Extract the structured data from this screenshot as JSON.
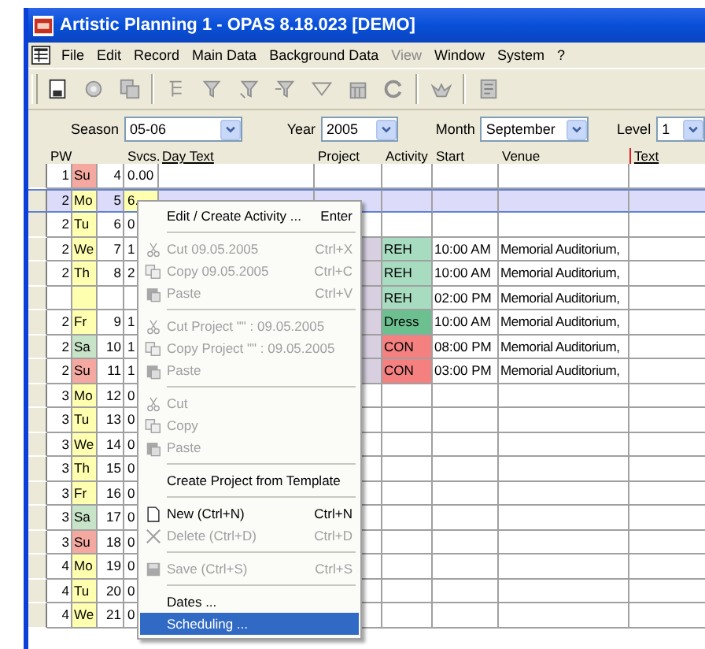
{
  "window": {
    "title": "Artistic Planning  1 - OPAS 8.18.023  [DEMO]"
  },
  "menu_bar": [
    {
      "label": "File",
      "disabled": false
    },
    {
      "label": "Edit",
      "disabled": false
    },
    {
      "label": "Record",
      "disabled": false
    },
    {
      "label": "Main Data",
      "disabled": false
    },
    {
      "label": "Background Data",
      "disabled": false
    },
    {
      "label": "View",
      "disabled": true
    },
    {
      "label": "Window",
      "disabled": false
    },
    {
      "label": "System",
      "disabled": false
    },
    {
      "label": "?",
      "disabled": false
    }
  ],
  "filters": [
    {
      "label": "Season",
      "value": "05-06"
    },
    {
      "label": "Year",
      "value": "2005"
    },
    {
      "label": "Month",
      "value": "September"
    },
    {
      "label": "Level",
      "value": "1"
    }
  ],
  "table": {
    "columns": [
      "PW",
      "Svcs.",
      "Day Text",
      "Project",
      "Activity",
      "Start",
      "Venue",
      "Text"
    ],
    "rows": [
      {
        "pw": "1",
        "day": {
          "text": "Su",
          "color": "#f4a8a0"
        },
        "date": "4",
        "svcs": "0.00",
        "selected": false
      },
      {
        "pw": "2",
        "day": {
          "text": "Mo",
          "color": "#ffffb0"
        },
        "date": "5",
        "svcs": "6.",
        "selected": true
      },
      {
        "pw": "2",
        "day": {
          "text": "Tu",
          "color": "#ffffb0"
        },
        "date": "6",
        "svcs": "0",
        "selected": false
      },
      {
        "pw": "2",
        "day": {
          "text": "We",
          "color": "#ffffb0"
        },
        "date": "7",
        "svcs": "1",
        "project": {
          "color": "#d8d0e0"
        },
        "activity": {
          "text": "REH",
          "color": "#a8dcc0"
        },
        "start": "10:00 AM",
        "venue": "Memorial Auditorium,",
        "selected": false
      },
      {
        "pw": "2",
        "day": {
          "text": "Th",
          "color": "#ffffb0"
        },
        "date": "8",
        "svcs": "2",
        "project": {
          "color": "#d8d0e0"
        },
        "activity": {
          "text": "REH",
          "color": "#a8dcc0"
        },
        "start": "10:00 AM",
        "venue": "Memorial Auditorium,",
        "selected": false
      },
      {
        "day": {
          "color": "#ffffb0"
        },
        "project": {
          "color": "#d8d0e0"
        },
        "activity": {
          "text": "REH",
          "color": "#a8dcc0"
        },
        "start": "02:00 PM",
        "venue": "Memorial Auditorium,",
        "selected": false
      },
      {
        "pw": "2",
        "day": {
          "text": "Fr",
          "color": "#ffffb0"
        },
        "date": "9",
        "svcs": "1",
        "project": {
          "color": "#d8d0e0"
        },
        "activity": {
          "text": "Dress",
          "color": "#6cc090"
        },
        "start": "10:00 AM",
        "venue": "Memorial Auditorium,",
        "selected": false
      },
      {
        "pw": "2",
        "day": {
          "text": "Sa",
          "color": "#c8e4c8"
        },
        "date": "10",
        "svcs": "1",
        "project": {
          "color": "#d8d0e0"
        },
        "activity": {
          "text": "CON",
          "color": "#f48080"
        },
        "start": "08:00 PM",
        "venue": "Memorial Auditorium,",
        "selected": false
      },
      {
        "pw": "2",
        "day": {
          "text": "Su",
          "color": "#f4a8a0"
        },
        "date": "11",
        "svcs": "1",
        "project": {
          "color": "#d8d0e0"
        },
        "activity": {
          "text": "CON",
          "color": "#f48080"
        },
        "start": "03:00 PM",
        "venue": "Memorial Auditorium,",
        "selected": false
      },
      {
        "pw": "3",
        "day": {
          "text": "Mo",
          "color": "#ffffb0"
        },
        "date": "12",
        "svcs": "0",
        "selected": false
      },
      {
        "pw": "3",
        "day": {
          "text": "Tu",
          "color": "#ffffb0"
        },
        "date": "13",
        "svcs": "0",
        "selected": false
      },
      {
        "pw": "3",
        "day": {
          "text": "We",
          "color": "#ffffb0"
        },
        "date": "14",
        "svcs": "0",
        "selected": false
      },
      {
        "pw": "3",
        "day": {
          "text": "Th",
          "color": "#ffffb0"
        },
        "date": "15",
        "svcs": "0",
        "selected": false
      },
      {
        "pw": "3",
        "day": {
          "text": "Fr",
          "color": "#ffffb0"
        },
        "date": "16",
        "svcs": "0",
        "selected": false
      },
      {
        "pw": "3",
        "day": {
          "text": "Sa",
          "color": "#c8e4c8"
        },
        "date": "17",
        "svcs": "0",
        "selected": false
      },
      {
        "pw": "3",
        "day": {
          "text": "Su",
          "color": "#f4a8a0"
        },
        "date": "18",
        "svcs": "0",
        "selected": false
      },
      {
        "pw": "4",
        "day": {
          "text": "Mo",
          "color": "#ffffb0"
        },
        "date": "19",
        "svcs": "0",
        "selected": false
      },
      {
        "pw": "4",
        "day": {
          "text": "Tu",
          "color": "#ffffb0"
        },
        "date": "20",
        "svcs": "0",
        "selected": false
      },
      {
        "pw": "4",
        "day": {
          "text": "We",
          "color": "#ffffb0"
        },
        "date": "21",
        "svcs": "0",
        "selected": false
      }
    ]
  },
  "context_menu": [
    {
      "kind": "plain",
      "label": "Edit / Create Activity ...",
      "shortcut": "Enter",
      "disabled": false,
      "selected": false
    },
    {
      "kind": "separator"
    },
    {
      "kind": "cut",
      "label": "Cut 09.05.2005",
      "shortcut": "Ctrl+X",
      "disabled": true,
      "selected": false
    },
    {
      "kind": "copy",
      "label": "Copy 09.05.2005",
      "shortcut": "Ctrl+C",
      "disabled": true,
      "selected": false
    },
    {
      "kind": "paste",
      "label": "Paste",
      "shortcut": "Ctrl+V",
      "disabled": true,
      "selected": false
    },
    {
      "kind": "separator"
    },
    {
      "kind": "cut",
      "label": "Cut Project \"\" : 09.05.2005",
      "disabled": true,
      "selected": false
    },
    {
      "kind": "copy",
      "label": "Copy Project \"\" : 09.05.2005",
      "disabled": true,
      "selected": false
    },
    {
      "kind": "paste",
      "label": "Paste",
      "disabled": true,
      "selected": false
    },
    {
      "kind": "separator"
    },
    {
      "kind": "cut",
      "label": "Cut",
      "disabled": true,
      "selected": false
    },
    {
      "kind": "copy",
      "label": "Copy",
      "disabled": true,
      "selected": false
    },
    {
      "kind": "paste",
      "label": "Paste",
      "disabled": true,
      "selected": false
    },
    {
      "kind": "separator"
    },
    {
      "kind": "plain",
      "label": "Create Project from Template",
      "disabled": false,
      "selected": false
    },
    {
      "kind": "separator"
    },
    {
      "kind": "new",
      "label": "New (Ctrl+N)",
      "shortcut": "Ctrl+N",
      "disabled": false,
      "selected": false
    },
    {
      "kind": "delete",
      "label": "Delete (Ctrl+D)",
      "shortcut": "Ctrl+D",
      "disabled": true,
      "selected": false
    },
    {
      "kind": "separator"
    },
    {
      "kind": "save",
      "label": "Save (Ctrl+S)",
      "shortcut": "Ctrl+S",
      "disabled": true,
      "selected": false
    },
    {
      "kind": "separator"
    },
    {
      "kind": "plain",
      "label": "Dates ...",
      "disabled": false,
      "selected": false
    },
    {
      "kind": "plain",
      "label": "Scheduling ...",
      "disabled": false,
      "selected": true
    }
  ]
}
